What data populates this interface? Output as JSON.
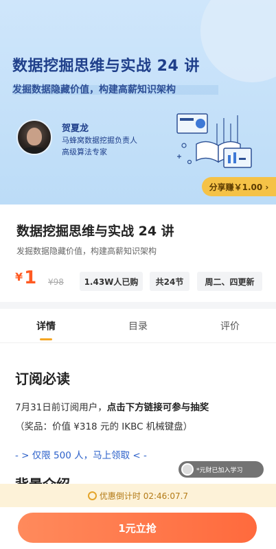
{
  "hero": {
    "title": "数据挖掘思维与实战 24 讲",
    "subtitle": "发掘数据隐藏价值，构建高薪知识架构",
    "teacher_name": "贺夏龙",
    "teacher_role_1": "马蜂窝数据挖掘负责人",
    "teacher_role_2": "高级算法专家",
    "share_label": "分享赚￥1.00 ›"
  },
  "course": {
    "title": "数据挖掘思维与实战 24 讲",
    "subtitle": "发掘数据隐藏价值，构建高薪知识架构",
    "price_symbol": "¥",
    "price": "1",
    "original_price": "¥98",
    "buyers": "1.43W人已购",
    "lessons": "共24节",
    "schedule": "周二、四更新"
  },
  "tabs": [
    {
      "label": "详情"
    },
    {
      "label": "目录"
    },
    {
      "label": "评价"
    }
  ],
  "content": {
    "section_title": "订阅必读",
    "para1_prefix": "7月31日前订阅用户，",
    "para1_bold": "点击下方链接可参与抽奖",
    "para2": "（奖品：价值 ¥318 元的 IKBC 机械键盘）",
    "promo_link": "- > 仅限 500 人，马上领取 < -",
    "section2_title": "背景介绍"
  },
  "toast": {
    "message": "*元财已加入学习"
  },
  "countdown": {
    "label": "优惠倒计时 02:46:07.7"
  },
  "buy_button": {
    "label": "1元立抢"
  },
  "colors": {
    "accent": "#ff6a3d",
    "link": "#2a5fc9",
    "hero_bg": "#bcdcf7",
    "share_bg": "#f5c247"
  }
}
